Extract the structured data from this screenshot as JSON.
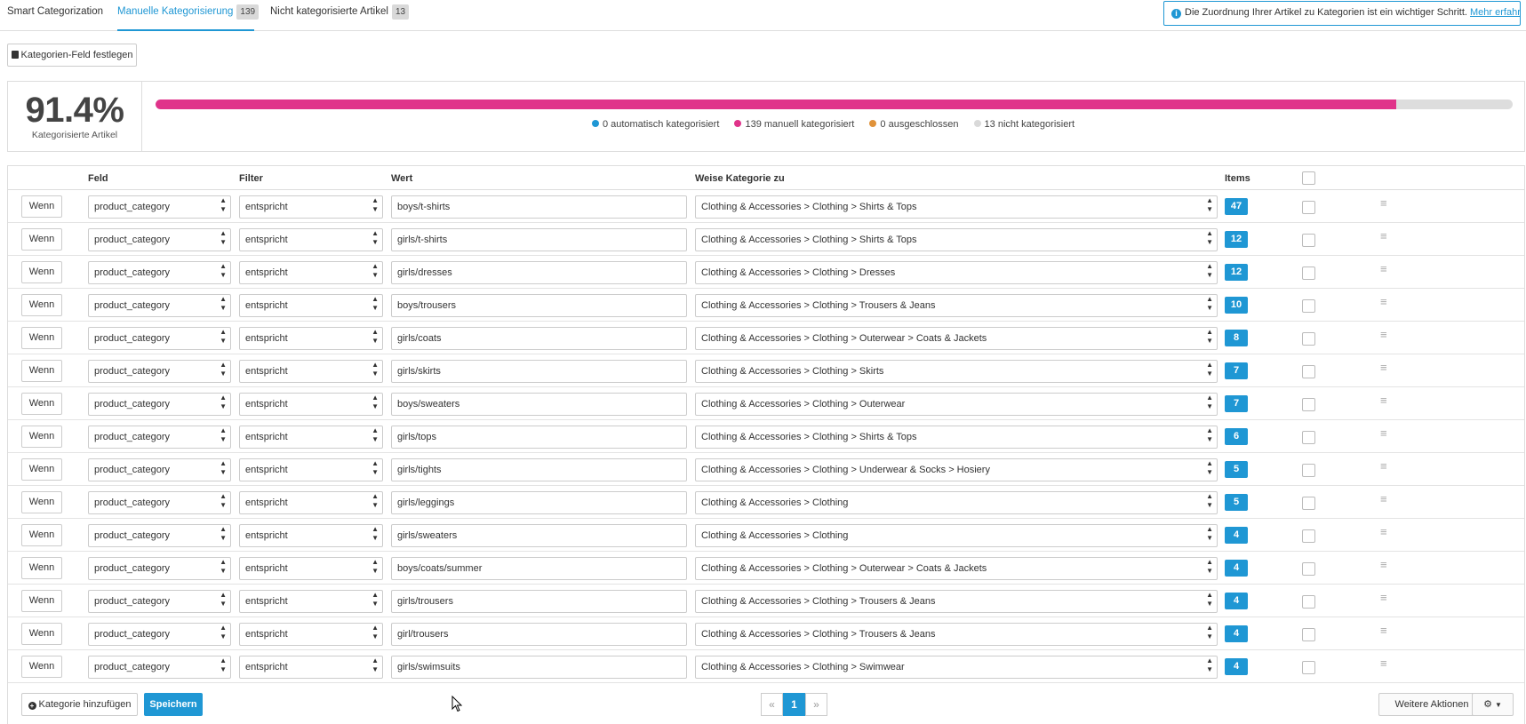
{
  "tabs": [
    {
      "label": "Smart Categorization",
      "badge": ""
    },
    {
      "label": "Manuelle Kategorisierung",
      "badge": "139"
    },
    {
      "label": "Nicht kategorisierte Artikel",
      "badge": "13"
    }
  ],
  "info": {
    "text": "Die Zuordnung Ihrer Artikel zu Kategorien ist ein wichtiger Schritt.",
    "link": "Mehr erfahren."
  },
  "set_field_button": "Kategorien-Feld festlegen",
  "stats": {
    "percent": "91.4%",
    "percent_label": "Kategorisierte Artikel",
    "progress_fraction": 0.914,
    "legend": [
      {
        "text": "0 automatisch kategorisiert",
        "color": "#1f97d4"
      },
      {
        "text": "139 manuell kategorisiert",
        "color": "#e0338a"
      },
      {
        "text": "0 ausgeschlossen",
        "color": "#e0923a"
      },
      {
        "text": "13 nicht kategorisiert",
        "color": "#d9d9d9"
      }
    ]
  },
  "table": {
    "headers": {
      "field": "Feld",
      "filter": "Filter",
      "value": "Wert",
      "category": "Weise Kategorie zu",
      "items": "Items"
    },
    "rows": [
      {
        "if": "Wenn",
        "field": "product_category",
        "filter": "entspricht",
        "value": "boys/t-shirts",
        "category": "Clothing & Accessories > Clothing > Shirts & Tops",
        "items": "47"
      },
      {
        "if": "Wenn",
        "field": "product_category",
        "filter": "entspricht",
        "value": "girls/t-shirts",
        "category": "Clothing & Accessories > Clothing > Shirts & Tops",
        "items": "12"
      },
      {
        "if": "Wenn",
        "field": "product_category",
        "filter": "entspricht",
        "value": "girls/dresses",
        "category": "Clothing & Accessories > Clothing > Dresses",
        "items": "12"
      },
      {
        "if": "Wenn",
        "field": "product_category",
        "filter": "entspricht",
        "value": "boys/trousers",
        "category": "Clothing & Accessories > Clothing > Trousers & Jeans",
        "items": "10"
      },
      {
        "if": "Wenn",
        "field": "product_category",
        "filter": "entspricht",
        "value": "girls/coats",
        "category": "Clothing & Accessories > Clothing > Outerwear > Coats & Jackets",
        "items": "8"
      },
      {
        "if": "Wenn",
        "field": "product_category",
        "filter": "entspricht",
        "value": "girls/skirts",
        "category": "Clothing & Accessories > Clothing > Skirts",
        "items": "7"
      },
      {
        "if": "Wenn",
        "field": "product_category",
        "filter": "entspricht",
        "value": "boys/sweaters",
        "category": "Clothing & Accessories > Clothing > Outerwear",
        "items": "7"
      },
      {
        "if": "Wenn",
        "field": "product_category",
        "filter": "entspricht",
        "value": "girls/tops",
        "category": "Clothing & Accessories > Clothing > Shirts & Tops",
        "items": "6"
      },
      {
        "if": "Wenn",
        "field": "product_category",
        "filter": "entspricht",
        "value": "girls/tights",
        "category": "Clothing & Accessories > Clothing > Underwear & Socks > Hosiery",
        "items": "5"
      },
      {
        "if": "Wenn",
        "field": "product_category",
        "filter": "entspricht",
        "value": "girls/leggings",
        "category": "Clothing & Accessories > Clothing",
        "items": "5"
      },
      {
        "if": "Wenn",
        "field": "product_category",
        "filter": "entspricht",
        "value": "girls/sweaters",
        "category": "Clothing & Accessories > Clothing",
        "items": "4"
      },
      {
        "if": "Wenn",
        "field": "product_category",
        "filter": "entspricht",
        "value": "boys/coats/summer",
        "category": "Clothing & Accessories > Clothing > Outerwear > Coats & Jackets",
        "items": "4"
      },
      {
        "if": "Wenn",
        "field": "product_category",
        "filter": "entspricht",
        "value": "girls/trousers",
        "category": "Clothing & Accessories > Clothing > Trousers & Jeans",
        "items": "4"
      },
      {
        "if": "Wenn",
        "field": "product_category",
        "filter": "entspricht",
        "value": "girl/trousers",
        "category": "Clothing & Accessories > Clothing > Trousers & Jeans",
        "items": "4"
      },
      {
        "if": "Wenn",
        "field": "product_category",
        "filter": "entspricht",
        "value": "girls/swimsuits",
        "category": "Clothing & Accessories > Clothing > Swimwear",
        "items": "4"
      }
    ]
  },
  "footer": {
    "add_category": "Kategorie hinzufügen",
    "save": "Speichern",
    "pagination": {
      "prev": "«",
      "current": "1",
      "next": "»"
    },
    "more_actions": "Weitere Aktionen"
  },
  "icons": {
    "info": "info-icon",
    "save_field": "floppy-icon",
    "add": "plus-circle-icon",
    "gear": "gear-icon",
    "drag": "drag-handle-icon"
  }
}
